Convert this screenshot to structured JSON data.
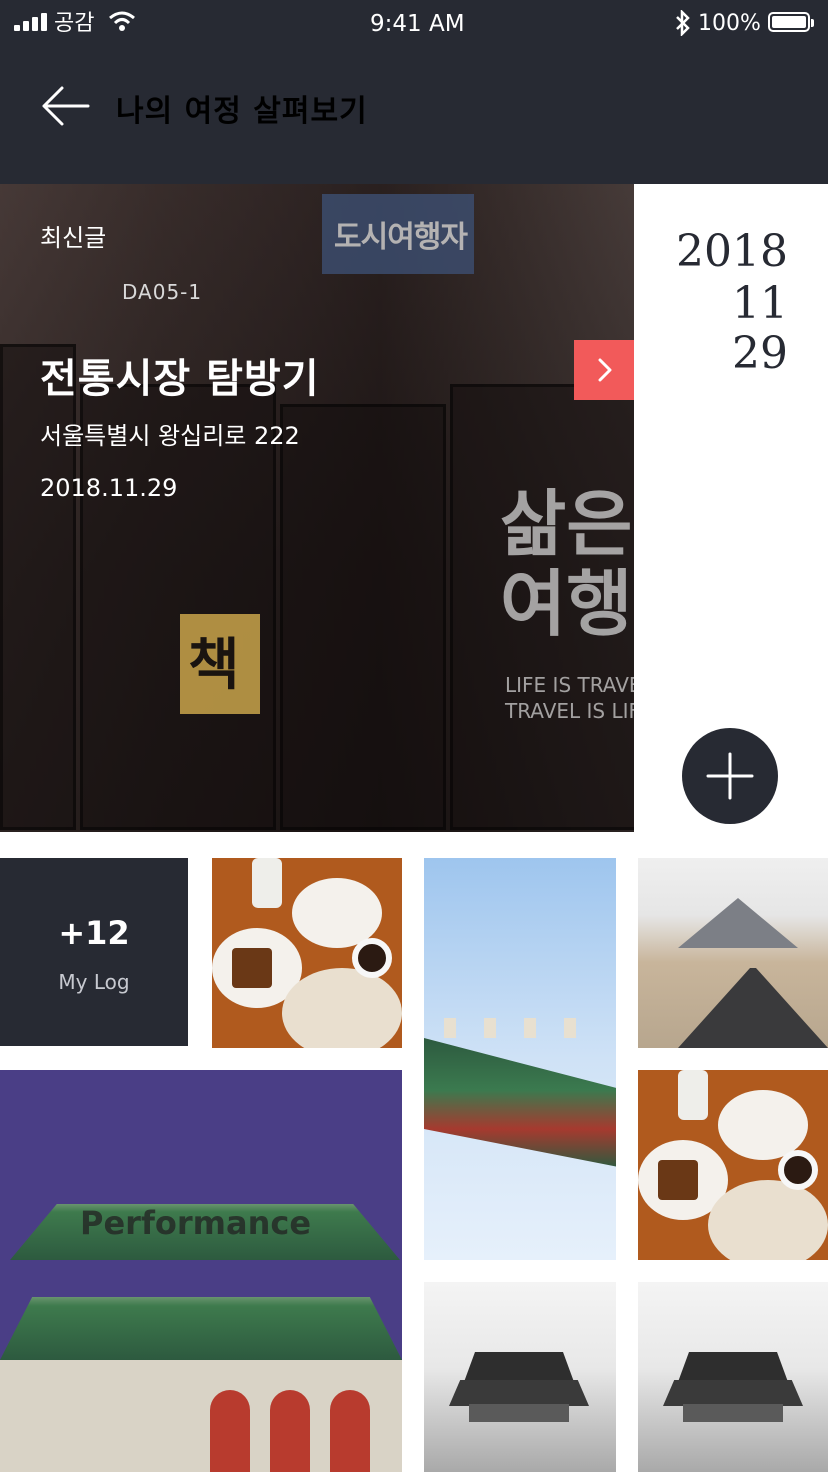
{
  "status_bar": {
    "carrier": "공감",
    "time": "9:41 AM",
    "battery": "100%"
  },
  "header": {
    "title": "나의 여정 살펴보기"
  },
  "hero": {
    "tag": "최신글",
    "title": "전통시장 탐방기",
    "address": "서울특별시 왕십리로 222",
    "date": "2018.11.29",
    "photo_sign": "도시여행자",
    "photo_code": "DA05-1",
    "photo_big_text": "삶은\n여행",
    "photo_eng_text": "LIFE IS TRAVEL\nTRAVEL IS LIFE",
    "photo_yellow_text": "책"
  },
  "date_column": {
    "year": "2018",
    "month": "11",
    "day": "29"
  },
  "grid": {
    "mylog_count": "+12",
    "mylog_label": "My Log",
    "gate_label": "Performance"
  },
  "colors": {
    "header_bg": "#272a33",
    "accent": "#f25a5a",
    "tile_dark": "#272a33"
  }
}
